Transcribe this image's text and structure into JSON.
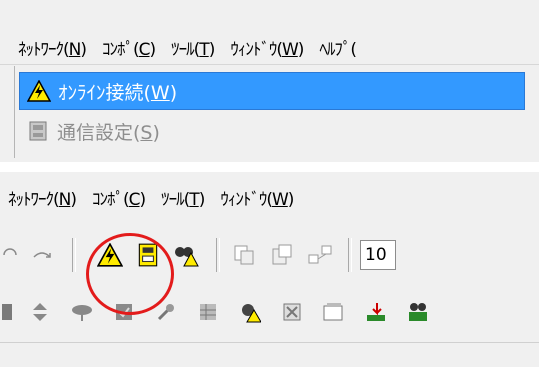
{
  "top_menu": {
    "items": [
      {
        "label": "ﾈｯﾄﾜｰｸ(",
        "key": "N",
        "suffix": ")"
      },
      {
        "label": "ｺﾝﾎﾟ(",
        "key": "C",
        "suffix": ")"
      },
      {
        "label": "ﾂｰﾙ(",
        "key": "T",
        "suffix": ")"
      },
      {
        "label": "ｳｨﾝﾄﾞｳ(",
        "key": "W",
        "suffix": ")"
      },
      {
        "label": "ﾍﾙﾌﾟ(",
        "key": "",
        "suffix": ""
      }
    ]
  },
  "dropdown": {
    "online": {
      "label": "ｵﾝﾗｲﾝ接続(",
      "key": "W",
      "suffix": ")"
    },
    "comm": {
      "label": "通信設定(",
      "key": "S",
      "suffix": ")"
    }
  },
  "bottom_menu": {
    "items": [
      {
        "label": "ﾈｯﾄﾜｰｸ(",
        "key": "N",
        "suffix": ")"
      },
      {
        "label": "ｺﾝﾎﾟ(",
        "key": "C",
        "suffix": ")"
      },
      {
        "label": "ﾂｰﾙ(",
        "key": "T",
        "suffix": ")"
      },
      {
        "label": "ｳｨﾝﾄﾞｳ(",
        "key": "W",
        "suffix": ")"
      }
    ]
  },
  "toolbar": {
    "zoom_value": "10",
    "icons": [
      "undo-icon",
      "redo-icon",
      "online-warning-icon",
      "comm-settings-icon",
      "binoculars-warning-icon",
      "copy-icon",
      "paste-icon",
      "network-icon"
    ]
  },
  "colors": {
    "highlight": "#3399ff",
    "annotation": "#e31b1b",
    "warning": "#ffeb00"
  }
}
